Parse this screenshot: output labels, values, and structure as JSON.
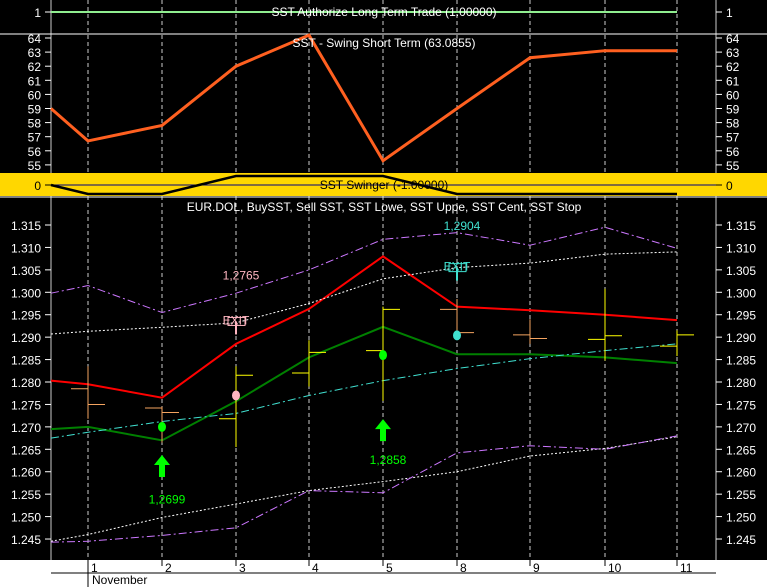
{
  "chart_data": [
    {
      "type": "line",
      "title": "SST Authorize Long Term Trade (1.00000)",
      "y_ticks": [
        1
      ],
      "series": [
        {
          "values": [
            1,
            1,
            1,
            1,
            1,
            1,
            1,
            1,
            1,
            1
          ],
          "color": "#90ee90"
        }
      ]
    },
    {
      "type": "line",
      "title": "SST - Swing Short Term (63.0855)",
      "ylim": [
        55,
        64
      ],
      "y_ticks": [
        55,
        56,
        57,
        58,
        59,
        60,
        61,
        62,
        63,
        64
      ],
      "series": [
        {
          "values": [
            59.0,
            56.7,
            57.8,
            62.0,
            64.2,
            55.3,
            59.0,
            62.6,
            63.1,
            63.1
          ],
          "color": "#ff6020"
        }
      ]
    },
    {
      "type": "line",
      "title": "SST Swinger (-1.00000)",
      "background": "#ffd700",
      "y_ticks": [
        0
      ],
      "series": [
        {
          "values": [
            0,
            -1,
            -1,
            1,
            1,
            1,
            -1,
            -1,
            -1,
            -1
          ],
          "color": "#000000"
        }
      ]
    },
    {
      "type": "ohlc",
      "title": "EUR.DOL, BuySST, Sell SST, SST Lowe, SST Uppe, SST Cent, SST Stop",
      "ylim": [
        1.245,
        1.315
      ],
      "y_ticks": [
        "1.245",
        "1.250",
        "1.255",
        "1.260",
        "1.265",
        "1.270",
        "1.275",
        "1.280",
        "1.285",
        "1.290",
        "1.295",
        "1.300",
        "1.305",
        "1.310",
        "1.315"
      ],
      "x_labels": [
        "1",
        "2",
        "3",
        "4",
        "5",
        "8",
        "9",
        "10",
        "11"
      ],
      "month_label": "November",
      "grid": "vertical-dashed",
      "bars": [
        {
          "day": "1",
          "open": 1.2785,
          "high": 1.2835,
          "low": 1.2718,
          "close": 1.275,
          "color": "#f4a460"
        },
        {
          "day": "2",
          "open": 1.2742,
          "high": 1.2745,
          "low": 1.2665,
          "close": 1.2732,
          "color": "#f4a460"
        },
        {
          "day": "3",
          "open": 1.2718,
          "high": 1.2835,
          "low": 1.2655,
          "close": 1.2815,
          "color": "#ffff00"
        },
        {
          "day": "4",
          "open": 1.282,
          "high": 1.2893,
          "low": 1.279,
          "close": 1.2866,
          "color": "#ffff00"
        },
        {
          "day": "5",
          "open": 1.287,
          "high": 1.2968,
          "low": 1.2758,
          "close": 1.2962,
          "color": "#ffff00"
        },
        {
          "day": "8",
          "open": 1.2962,
          "high": 1.2985,
          "low": 1.2905,
          "close": 1.291,
          "color": "#f4a460"
        },
        {
          "day": "9",
          "open": 1.2905,
          "high": 1.294,
          "low": 1.2885,
          "close": 1.2897,
          "color": "#f4a460"
        },
        {
          "day": "10",
          "open": 1.2895,
          "high": 1.3008,
          "low": 1.2848,
          "close": 1.2903,
          "color": "#ffff00"
        },
        {
          "day": "11",
          "open": 1.288,
          "high": 1.2915,
          "low": 1.2858,
          "close": 1.2905,
          "color": "#ffff00"
        }
      ],
      "lines": [
        {
          "values": [
            1.2803,
            1.2795,
            1.2765,
            1.2885,
            1.2963,
            1.308,
            1.2968,
            1.296,
            1.295,
            1.2938
          ],
          "color": "#ff0000",
          "style": "solid"
        },
        {
          "values": [
            1.2695,
            1.27,
            1.267,
            1.2757,
            1.2855,
            1.2923,
            1.2862,
            1.2862,
            1.2855,
            1.2842
          ],
          "color": "#008000",
          "style": "solid"
        },
        {
          "values": [
            1.2998,
            1.3015,
            1.2955,
            1.2998,
            1.305,
            1.3118,
            1.3133,
            1.3105,
            1.3145,
            1.3098
          ],
          "color": "#cc77ff",
          "style": "dashdot"
        },
        {
          "values": [
            1.2907,
            1.2913,
            1.2922,
            1.2932,
            1.2975,
            1.303,
            1.3055,
            1.3065,
            1.3085,
            1.309
          ],
          "color": "#ffffff",
          "style": "dotted"
        },
        {
          "values": [
            1.2675,
            1.2688,
            1.2712,
            1.273,
            1.277,
            1.2803,
            1.283,
            1.2852,
            1.287,
            1.2885
          ],
          "color": "#40e0d0",
          "style": "dashdot"
        },
        {
          "values": [
            1.2445,
            1.246,
            1.2498,
            1.2528,
            1.2558,
            1.2578,
            1.26,
            1.2635,
            1.2652,
            1.2678
          ],
          "color": "#ffffff",
          "style": "dotted"
        },
        {
          "values": [
            1.2443,
            1.2445,
            1.2458,
            1.2475,
            1.2558,
            1.2553,
            1.2642,
            1.2658,
            1.265,
            1.268
          ],
          "color": "#cc77ff",
          "style": "dashdot"
        }
      ],
      "dots": [
        {
          "day": "2",
          "value": 1.27,
          "color": "#00ff00"
        },
        {
          "day": "3",
          "value": 1.277,
          "color": "#ffb6c1"
        },
        {
          "day": "5",
          "value": 1.286,
          "color": "#00ff00"
        },
        {
          "day": "8",
          "value": 1.2904,
          "color": "#40e0d0"
        }
      ],
      "buy_arrows": [
        {
          "day": "2",
          "value": 1.2615
        },
        {
          "day": "5",
          "value": 1.2695
        }
      ],
      "exit_flags": [
        {
          "day": "3",
          "value": 1.2935,
          "label": "EXIT",
          "color": "#ffb6c1"
        },
        {
          "day": "8",
          "value": 1.3055,
          "label": "EXIT",
          "color": "#40e0d0"
        }
      ],
      "annotations": [
        {
          "text": "1,2699",
          "day": "2",
          "value": 1.254,
          "color": "#00ff00"
        },
        {
          "text": "1,2858",
          "day": "5",
          "value": 1.2628,
          "color": "#00ff00"
        },
        {
          "text": "1,2765",
          "day": "3",
          "value": 1.304,
          "color": "#ffb6c1"
        },
        {
          "text": "1,2904",
          "day": "8",
          "value": 1.315,
          "color": "#40e0d0"
        }
      ]
    }
  ]
}
